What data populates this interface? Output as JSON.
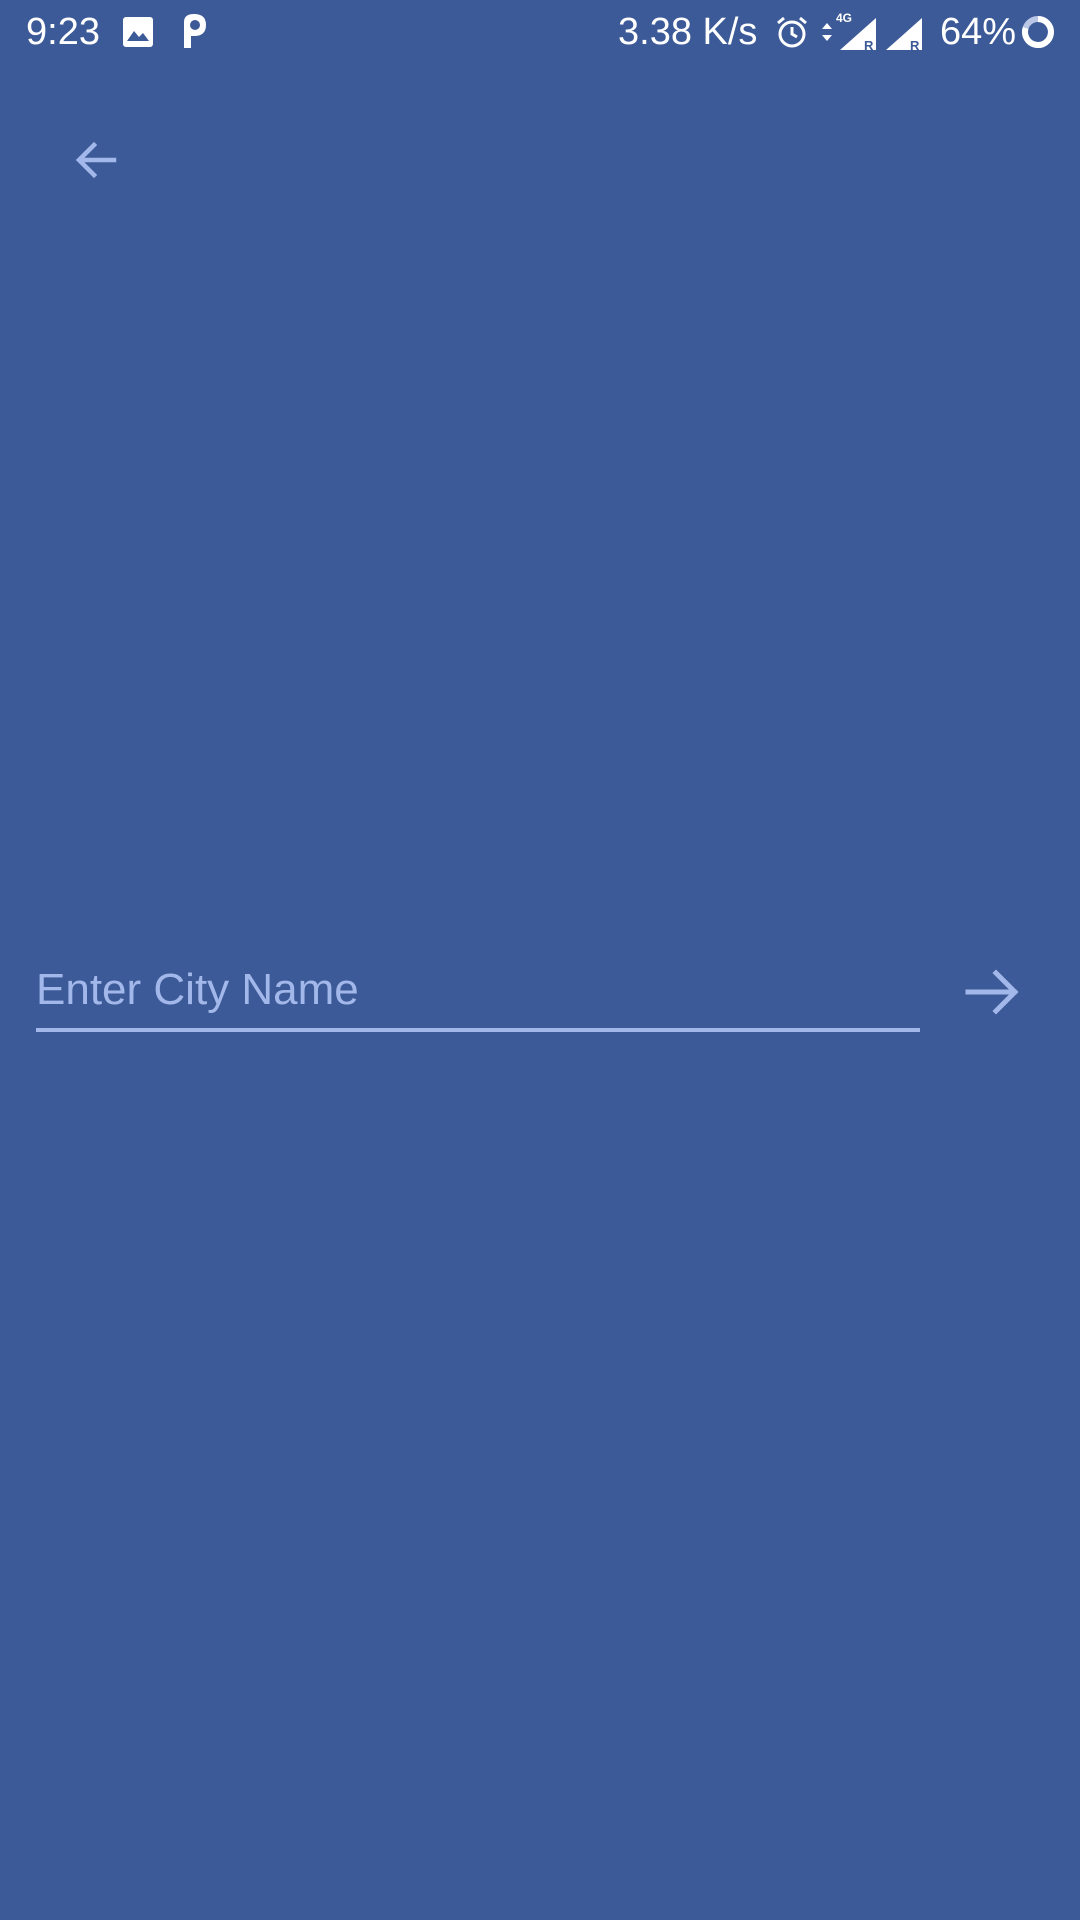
{
  "status_bar": {
    "time": "9:23",
    "network_speed": "3.38 K/s",
    "battery_percent": "64%",
    "icons": [
      "image-icon",
      "parking-app-icon",
      "alarm-icon",
      "data-arrows-icon",
      "signal-4g-roaming-icon",
      "signal-roaming-icon",
      "battery-ring-icon"
    ],
    "network_type": "4G",
    "roaming_marker": "R"
  },
  "toolbar": {
    "back_icon": "arrow-left-icon"
  },
  "search": {
    "value": "",
    "placeholder": "Enter City Name",
    "submit_icon": "arrow-right-icon"
  },
  "colors": {
    "background": "#3d5a98",
    "accent": "#a3b8ea",
    "status_text": "#ffffff"
  }
}
